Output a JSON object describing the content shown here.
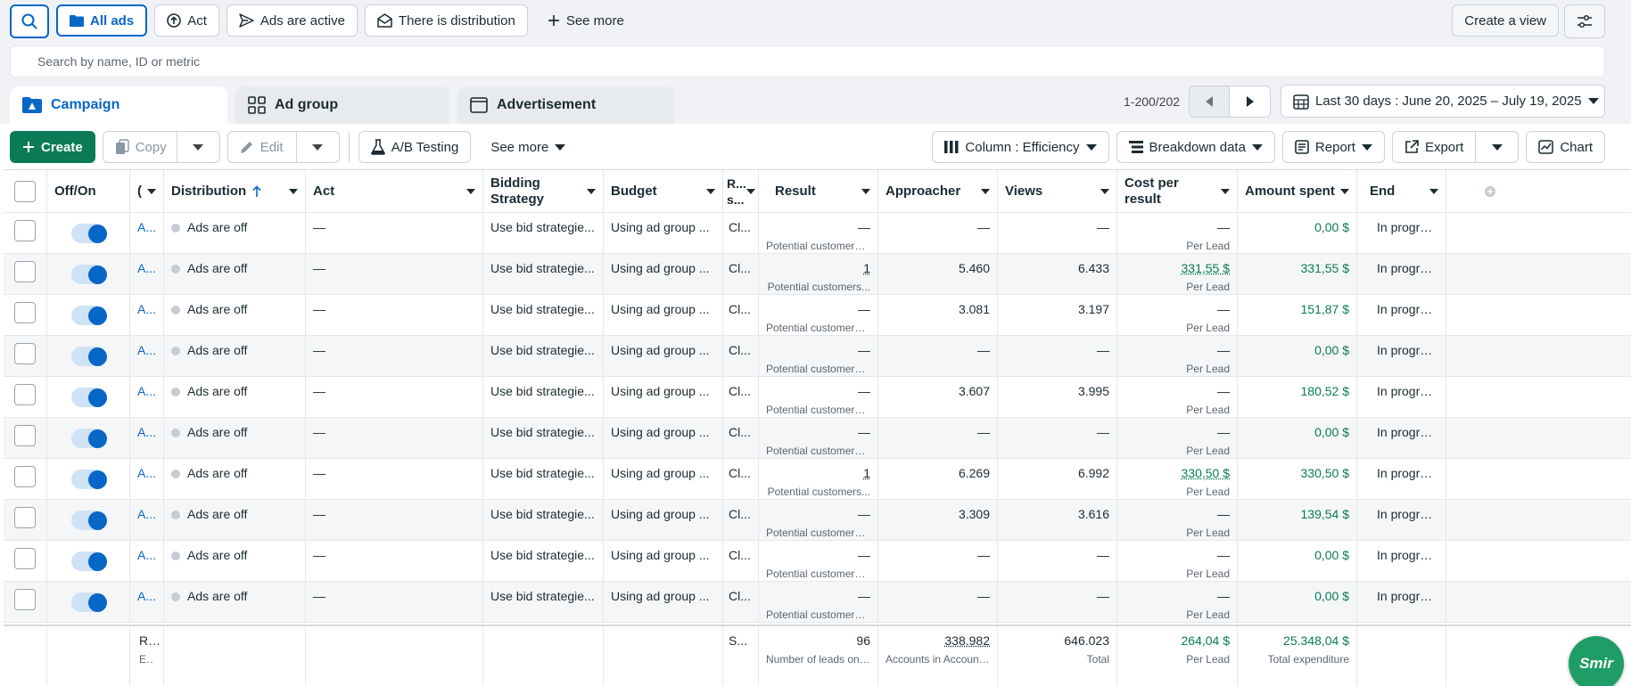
{
  "filters": {
    "all_ads": "All ads",
    "act": "Act",
    "ads_active": "Ads are active",
    "distribution": "There is distribution",
    "see_more": "See more",
    "create_view": "Create a view"
  },
  "search": {
    "placeholder": "Search by name, ID or metric"
  },
  "tabs": {
    "campaign": "Campaign",
    "ad_group": "Ad group",
    "advertisement": "Advertisement"
  },
  "pager": {
    "count": "1-200/202"
  },
  "date_range": "Last 30 days : June 20, 2025 – July 19, 2025",
  "toolbar": {
    "create": "Create",
    "copy": "Copy",
    "edit": "Edit",
    "ab_testing": "A/B Testing",
    "see_more": "See more",
    "column": "Column : Efficiency",
    "breakdown": "Breakdown data",
    "report": "Report",
    "export": "Export",
    "chart": "Chart"
  },
  "table": {
    "headers": {
      "off_on": "Off/On",
      "name": "(",
      "distribution": "Distribution",
      "act": "Act",
      "bidding": "Bidding Strategy",
      "budget": "Budget",
      "rs": "R... s...",
      "result": "Result",
      "approacher": "Approacher",
      "views": "Views",
      "cost": "Cost per result",
      "amount": "Amount spent",
      "end": "End"
    },
    "rows": [
      {
        "name": "A...",
        "distribution": "Ads are off",
        "act": "—",
        "bidding": "Use bid strategie...",
        "budget": "Using ad group ...",
        "rs": "Cl...",
        "result": "—",
        "result_sub": "Potential customers ...",
        "approacher": "—",
        "views": "—",
        "cost": "—",
        "cost_sub": "Per Lead",
        "amount": "0,00 $",
        "end": "In progress"
      },
      {
        "name": "A...",
        "distribution": "Ads are off",
        "act": "—",
        "bidding": "Use bid strategie...",
        "budget": "Using ad group ...",
        "rs": "Cl...",
        "result": "1",
        "result_sub": "Potential customers...",
        "approacher": "5.460",
        "views": "6.433",
        "cost": "331,55 $",
        "cost_sub": "Per Lead",
        "amount": "331,55 $",
        "end": "In progress"
      },
      {
        "name": "A...",
        "distribution": "Ads are off",
        "act": "—",
        "bidding": "Use bid strategie...",
        "budget": "Using ad group ...",
        "rs": "Cl...",
        "result": "—",
        "result_sub": "Potential customers ...",
        "approacher": "3.081",
        "views": "3.197",
        "cost": "—",
        "cost_sub": "Per Lead",
        "amount": "151,87 $",
        "end": "In progress"
      },
      {
        "name": "A...",
        "distribution": "Ads are off",
        "act": "—",
        "bidding": "Use bid strategie...",
        "budget": "Using ad group ...",
        "rs": "Cl...",
        "result": "—",
        "result_sub": "Potential customers ...",
        "approacher": "—",
        "views": "—",
        "cost": "—",
        "cost_sub": "Per Lead",
        "amount": "0,00 $",
        "end": "In progress"
      },
      {
        "name": "A...",
        "distribution": "Ads are off",
        "act": "—",
        "bidding": "Use bid strategie...",
        "budget": "Using ad group ...",
        "rs": "Cl...",
        "result": "—",
        "result_sub": "Potential customers ...",
        "approacher": "3.607",
        "views": "3.995",
        "cost": "—",
        "cost_sub": "Per Lead",
        "amount": "180,52 $",
        "end": "In progress"
      },
      {
        "name": "A...",
        "distribution": "Ads are off",
        "act": "—",
        "bidding": "Use bid strategie...",
        "budget": "Using ad group ...",
        "rs": "Cl...",
        "result": "—",
        "result_sub": "Potential customers ...",
        "approacher": "—",
        "views": "—",
        "cost": "—",
        "cost_sub": "Per Lead",
        "amount": "0,00 $",
        "end": "In progress"
      },
      {
        "name": "A...",
        "distribution": "Ads are off",
        "act": "—",
        "bidding": "Use bid strategie...",
        "budget": "Using ad group ...",
        "rs": "Cl...",
        "result": "1",
        "result_sub": "Potential customers...",
        "approacher": "6.269",
        "views": "6.992",
        "cost": "330,50 $",
        "cost_sub": "Per Lead",
        "amount": "330,50 $",
        "end": "In progress"
      },
      {
        "name": "A...",
        "distribution": "Ads are off",
        "act": "—",
        "bidding": "Use bid strategie...",
        "budget": "Using ad group ...",
        "rs": "Cl...",
        "result": "—",
        "result_sub": "Potential customers ...",
        "approacher": "3.309",
        "views": "3.616",
        "cost": "—",
        "cost_sub": "Per Lead",
        "amount": "139,54 $",
        "end": "In progress"
      },
      {
        "name": "A...",
        "distribution": "Ads are off",
        "act": "—",
        "bidding": "Use bid strategie...",
        "budget": "Using ad group ...",
        "rs": "Cl...",
        "result": "—",
        "result_sub": "Potential customers ...",
        "approacher": "—",
        "views": "—",
        "cost": "—",
        "cost_sub": "Per Lead",
        "amount": "0,00 $",
        "end": "In progress"
      },
      {
        "name": "A...",
        "distribution": "Ads are off",
        "act": "—",
        "bidding": "Use bid strategie...",
        "budget": "Using ad group ...",
        "rs": "Cl...",
        "result": "—",
        "result_sub": "Potential customers ...",
        "approacher": "—",
        "views": "—",
        "cost": "—",
        "cost_sub": "Per Lead",
        "amount": "0,00 $",
        "end": "In progress"
      }
    ],
    "footer": {
      "name": "Res",
      "name_sub": "Ex...",
      "rs": "S...",
      "result": "96",
      "result_sub": "Number of leads on ...",
      "approacher": "338.982",
      "approacher_sub": "Accounts in Account...",
      "views": "646.023",
      "views_sub": "Total",
      "cost": "264,04 $",
      "cost_sub": "Per Lead",
      "amount": "25.348,04 $",
      "amount_sub": "Total expenditure"
    }
  },
  "logo_text": "Smir"
}
